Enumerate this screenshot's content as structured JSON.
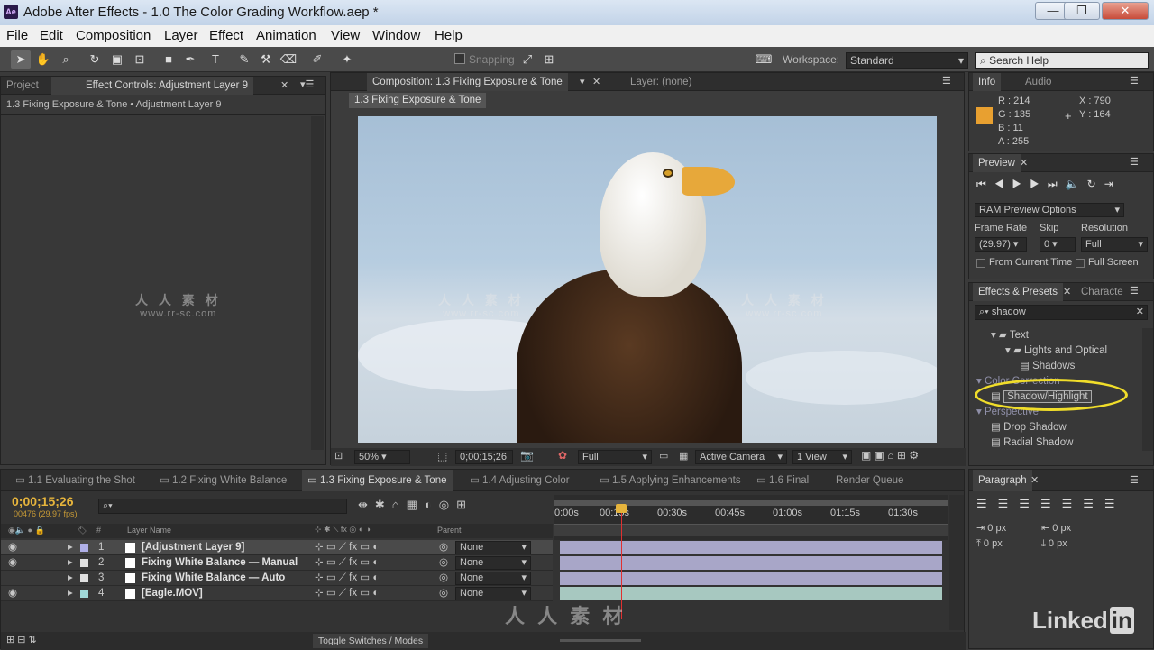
{
  "window": {
    "title": "Adobe After Effects - 1.0 The Color Grading Workflow.aep *",
    "app_icon": "Ae",
    "min": "—",
    "max": "❐",
    "close": "✕"
  },
  "menu": [
    "File",
    "Edit",
    "Composition",
    "Layer",
    "Effect",
    "Animation",
    "View",
    "Window",
    "Help"
  ],
  "toolbar": {
    "snapping": "Snapping",
    "workspace_label": "Workspace:",
    "workspace_value": "Standard",
    "search_placeholder": "Search Help"
  },
  "left_panel": {
    "tab_project": "Project",
    "tab_effect_controls": "Effect Controls: Adjustment Layer 9",
    "subtitle": "1.3 Fixing Exposure & Tone • Adjustment Layer 9"
  },
  "comp_panel": {
    "tab": "Composition: 1.3 Fixing Exposure & Tone",
    "layer_tab": "Layer: (none)",
    "breadcrumb": "1.3 Fixing Exposure & Tone",
    "zoom": "50%",
    "timecode": "0;00;15;26",
    "resolution": "Full",
    "camera": "Active Camera",
    "views": "1 View"
  },
  "info": {
    "tab": "Info",
    "tab_audio": "Audio",
    "r": "R : 214",
    "g": "G : 135",
    "b": "B : 11",
    "a": "A : 255",
    "x": "X : 790",
    "y": "Y : 164",
    "swatch": "#e8a030"
  },
  "preview": {
    "tab": "Preview",
    "ram_options": "RAM Preview Options",
    "frame_rate_label": "Frame Rate",
    "skip_label": "Skip",
    "resolution_label": "Resolution",
    "frame_rate": "(29.97)",
    "skip": "0",
    "resolution": "Full",
    "from_current": "From Current Time",
    "full_screen": "Full Screen"
  },
  "effects": {
    "tab": "Effects & Presets",
    "tab2": "Characte",
    "search": "shadow",
    "tree": [
      {
        "label": "Text",
        "indent": 1,
        "kind": "folder"
      },
      {
        "label": "Lights and Optical",
        "indent": 2,
        "kind": "folder"
      },
      {
        "label": "Shadows",
        "indent": 3,
        "kind": "fx"
      },
      {
        "label": "Color Correction",
        "indent": 0,
        "kind": "category"
      },
      {
        "label": "Shadow/Highlight",
        "indent": 1,
        "kind": "fx"
      },
      {
        "label": "Perspective",
        "indent": 0,
        "kind": "category"
      },
      {
        "label": "Drop Shadow",
        "indent": 1,
        "kind": "fx"
      },
      {
        "label": "Radial Shadow",
        "indent": 1,
        "kind": "fx"
      }
    ]
  },
  "timeline": {
    "tabs": [
      "1.1 Evaluating the Shot",
      "1.2 Fixing White Balance",
      "1.3 Fixing Exposure & Tone",
      "1.4 Adjusting Color",
      "1.5 Applying Enhancements",
      "1.6 Final",
      "Render Queue"
    ],
    "timecode": "0;00;15;26",
    "frames": "00476 (29.97 fps)",
    "col_hash": "#",
    "col_layer_name": "Layer Name",
    "col_parent": "Parent",
    "ruler": [
      "0:00s",
      "00:15s",
      "00:30s",
      "00:45s",
      "01:00s",
      "01:15s",
      "01:30s"
    ],
    "layers": [
      {
        "num": "1",
        "name": "[Adjustment Layer 9]",
        "parent": "None",
        "color": "#b0b0e8",
        "bar": "#a8a6c8"
      },
      {
        "num": "2",
        "name": "Fixing White Balance — Manual",
        "parent": "None",
        "color": "#e0e0e0",
        "bar": "#a8a6c8"
      },
      {
        "num": "3",
        "name": "Fixing White Balance — Auto",
        "parent": "None",
        "color": "#e0e0e0",
        "bar": "#a8a6c8"
      },
      {
        "num": "4",
        "name": "[Eagle.MOV]",
        "parent": "None",
        "color": "#a0d8d8",
        "bar": "#a7c8c0"
      }
    ],
    "toggle": "Toggle Switches / Modes"
  },
  "paragraph": {
    "tab": "Paragraph",
    "v1": "0 px",
    "v2": "0 px",
    "v3": "0 px",
    "v4": "0 px",
    "v5": "0 px"
  },
  "watermark": {
    "cn": "人 人 素 材",
    "url": "www.rr-sc.com",
    "brand": "Linked",
    "brand_in": "in"
  }
}
